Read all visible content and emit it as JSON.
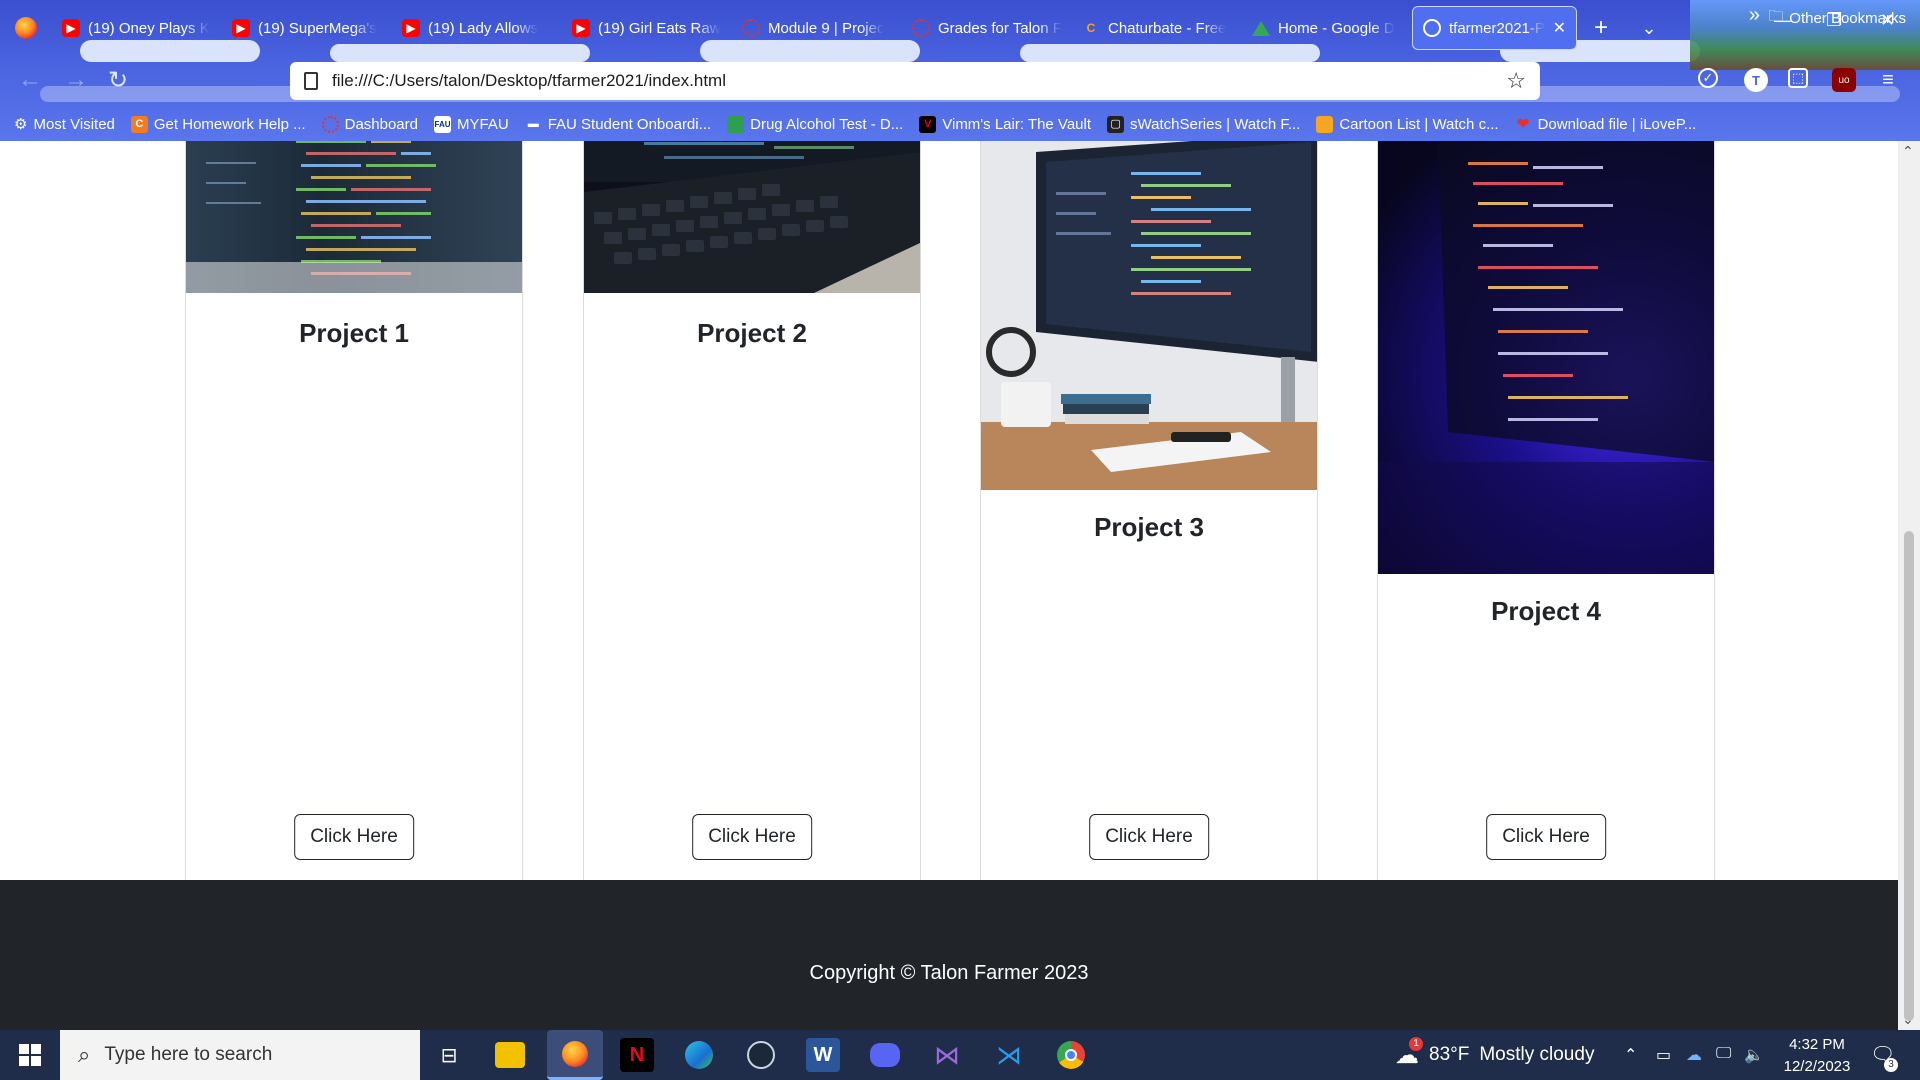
{
  "browser": {
    "tabs": [
      {
        "title": "(19) Oney Plays K",
        "favicon": "youtube-icon"
      },
      {
        "title": "(19) SuperMega's",
        "favicon": "youtube-icon"
      },
      {
        "title": "(19) Lady Allows",
        "favicon": "youtube-icon"
      },
      {
        "title": "(19) Girl Eats Raw",
        "favicon": "youtube-icon"
      },
      {
        "title": "Module 9 | Projec",
        "favicon": "canvas-icon"
      },
      {
        "title": "Grades for Talon F",
        "favicon": "canvas-icon"
      },
      {
        "title": "Chaturbate - Free",
        "favicon": "chaturbate-icon"
      },
      {
        "title": "Home - Google D",
        "favicon": "google-drive-icon"
      },
      {
        "title": "tfarmer2021-P",
        "favicon": "globe-icon",
        "active": true
      }
    ],
    "new_tab": "+",
    "url": "file:///C:/Users/talon/Desktop/tfarmer2021/index.html",
    "bookmarks": [
      {
        "label": "Most Visited",
        "icon": "gear-icon"
      },
      {
        "label": "Get Homework Help ...",
        "icon": "chegg-icon"
      },
      {
        "label": "Dashboard",
        "icon": "canvas-icon"
      },
      {
        "label": "MYFAU",
        "icon": "myfau-icon"
      },
      {
        "label": "FAU Student Onboardi...",
        "icon": "fau-icon"
      },
      {
        "label": "Drug Alcohol Test - D...",
        "icon": "bookmark-icon"
      },
      {
        "label": "Vimm's Lair: The Vault",
        "icon": "vimm-icon"
      },
      {
        "label": "sWatchSeries | Watch F...",
        "icon": "watchseries-icon"
      },
      {
        "label": "Cartoon List | Watch c...",
        "icon": "cartoon-icon"
      },
      {
        "label": "Download file | iLoveP...",
        "icon": "ilovepdf-icon"
      }
    ],
    "other_bookmarks": "Other Bookmarks",
    "profile_initial": "T"
  },
  "page": {
    "projects": [
      {
        "title": "Project 1",
        "button": "Click Here"
      },
      {
        "title": "Project 2",
        "button": "Click Here"
      },
      {
        "title": "Project 3",
        "button": "Click Here"
      },
      {
        "title": "Project 4",
        "button": "Click Here"
      }
    ],
    "footer": "Copyright © Talon Farmer 2023"
  },
  "taskbar": {
    "search_placeholder": "Type here to search",
    "weather": {
      "temp": "83°F",
      "condition": "Mostly cloudy",
      "alert_count": "1"
    },
    "time": "4:32 PM",
    "date": "12/2/2023",
    "notification_count": "3"
  },
  "colors": {
    "footer_bg": "#212529",
    "text_dark": "#212529",
    "chrome_blue": "#4a63e0",
    "taskbar": "#1f2c4a"
  }
}
